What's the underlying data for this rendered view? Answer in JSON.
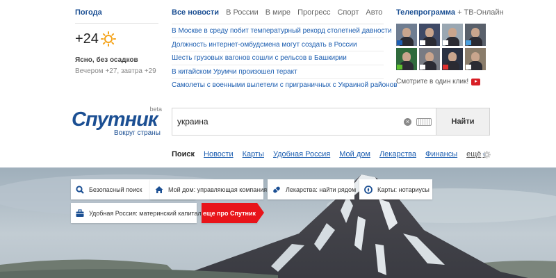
{
  "weather": {
    "title": "Погода",
    "temp": "+24",
    "condition": "Ясно, без осадков",
    "forecast": "Вечером +27, завтра +29",
    "icon": "sun-icon"
  },
  "news": {
    "tabs": [
      "Все новости",
      "В России",
      "В мире",
      "Прогресс",
      "Спорт",
      "Авто"
    ],
    "active_tab": "Все новости",
    "items": [
      "В Москве в среду побит температурный рекорд столетней давности",
      "Должность интернет-омбудсмена могут создать в России",
      "Шесть грузовых вагонов сошли с рельсов в Башкирии",
      "В китайском Урумчи произошел теракт",
      "Самолеты с военными вылетели с приграничных с Украиной районов"
    ]
  },
  "tv": {
    "title": "Телепрограмма",
    "title_suffix": "+ ТВ-Онлайн",
    "watch_label": "Смотрите в один клик!",
    "watch_icon": "youtube-icon",
    "thumbs": [
      {
        "bg": "#6f7d91",
        "ch": "#1d5fb4"
      },
      {
        "bg": "#3f4a66",
        "ch": "#ffffff"
      },
      {
        "bg": "#9aa7b2",
        "ch": "#ffffff"
      },
      {
        "bg": "#59606b",
        "ch": "#4aa0e0"
      },
      {
        "bg": "#2f6a3c",
        "ch": "#5fbf2e"
      },
      {
        "bg": "#787b83",
        "ch": "#ffffff"
      },
      {
        "bg": "#2a3142",
        "ch": "#e03030"
      },
      {
        "bg": "#8a7c6a",
        "ch": "#ffffff"
      }
    ]
  },
  "logo": {
    "name": "Спутник",
    "badge": "beta",
    "tagline": "Вокруг страны"
  },
  "search": {
    "value": "украина",
    "button_label": "Найти",
    "clear_icon": "clear-icon",
    "keyboard_icon": "keyboard-icon"
  },
  "services": {
    "tabs": [
      "Поиск",
      "Новости",
      "Карты",
      "Удобная Россия",
      "Мой дом",
      "Лекарства",
      "Финансы"
    ],
    "active_tab": "Поиск",
    "more_label": "ещё",
    "settings_icon": "gear-icon"
  },
  "quick_links": [
    {
      "label": "Безопасный поиск",
      "icon": "search-icon"
    },
    {
      "label": "Мой дом: управляющая компания",
      "icon": "home-icon"
    },
    {
      "label": "Лекарства: найти рядом",
      "icon": "pill-icon"
    },
    {
      "label": "Карты: нотариусы",
      "icon": "compass-icon"
    },
    {
      "label": "Удобная Россия: материнский капитал",
      "icon": "briefcase-icon"
    },
    {
      "label": "еще про Спутник",
      "icon": "arrow-icon"
    }
  ],
  "colors": {
    "brand_blue": "#1b4f93",
    "link_blue": "#1b5db0",
    "accent_red": "#e8141a",
    "sun": "#f5a31a"
  }
}
